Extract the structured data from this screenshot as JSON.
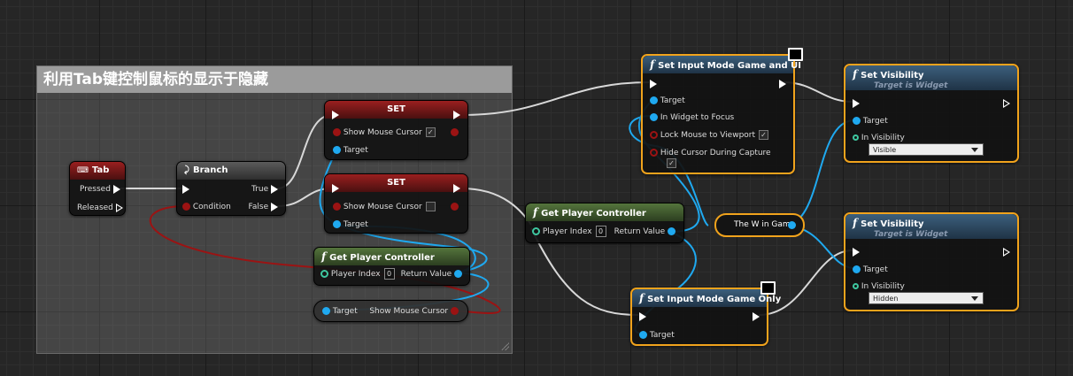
{
  "comment": {
    "title": "利用Tab键控制鼠标的显示于隐藏"
  },
  "nodes": {
    "tab": {
      "title": "Tab",
      "pressed": "Pressed",
      "released": "Released"
    },
    "branch": {
      "title": "Branch",
      "condition": "Condition",
      "true_label": "True",
      "false_label": "False"
    },
    "set1": {
      "title": "SET",
      "pin": "Show Mouse Cursor",
      "target": "Target",
      "checked": true
    },
    "set2": {
      "title": "SET",
      "pin": "Show Mouse Cursor",
      "target": "Target",
      "checked": false
    },
    "gpc1": {
      "title": "Get Player Controller",
      "player_index": "Player Index",
      "index_value": "0",
      "return_value": "Return Value"
    },
    "getter": {
      "target": "Target",
      "value": "Show Mouse Cursor"
    },
    "gpc2": {
      "title": "Get Player Controller",
      "player_index": "Player Index",
      "index_value": "0",
      "return_value": "Return Value"
    },
    "smgui": {
      "title": "Set Input Mode Game and UI",
      "target": "Target",
      "in_widget": "In Widget to Focus",
      "lock_mouse": "Lock Mouse to Viewport",
      "hide_cursor": "Hide Cursor During Capture"
    },
    "wingame": {
      "title": "The W in Game"
    },
    "sv1": {
      "title": "Set Visibility",
      "subtitle": "Target is Widget",
      "target": "Target",
      "in_visibility": "In Visibility",
      "value": "Visible"
    },
    "sv2": {
      "title": "Set Visibility",
      "subtitle": "Target is Widget",
      "target": "Target",
      "in_visibility": "In Visibility",
      "value": "Hidden"
    },
    "smgo": {
      "title": "Set Input Mode Game Only",
      "target": "Target"
    }
  },
  "colors": {
    "selected_border": "#f1a31c",
    "object_wire": "#1fa9f0",
    "bool_wire": "#9b1313",
    "exec_wire": "#d8d8d8"
  }
}
